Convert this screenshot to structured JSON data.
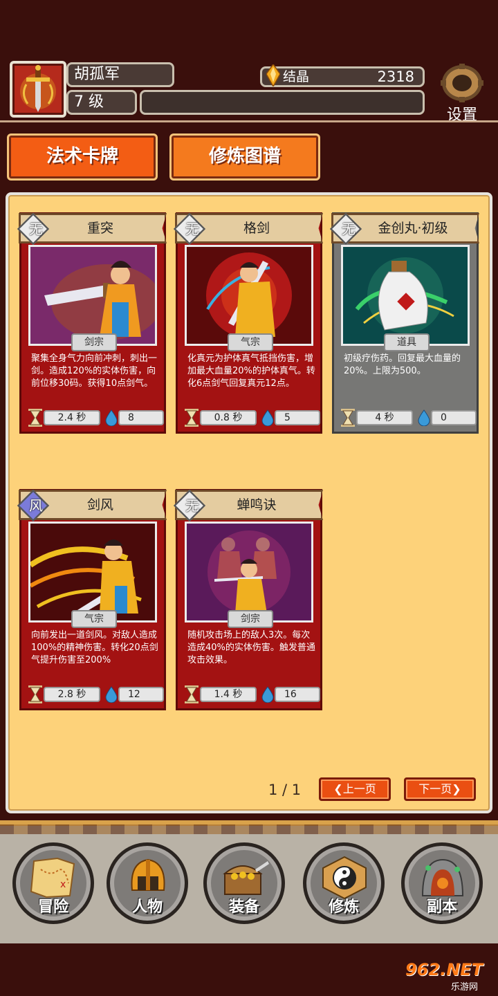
{
  "player": {
    "name": "胡孤军",
    "level": "7 级",
    "crystal_label": "结晶",
    "crystal_value": "2318"
  },
  "settings_label": "设置",
  "tabs": [
    {
      "label": "法术卡牌"
    },
    {
      "label": "修炼图谱"
    }
  ],
  "cards": [
    {
      "title": "重突",
      "element": "无",
      "type": "剑宗",
      "desc": "聚集全身气力向前冲刺，刺出一剑。造成120%的实体伤害，向前位移30码。获得10点剑气。",
      "time": "2.4 秒",
      "cost": "8"
    },
    {
      "title": "格剑",
      "element": "无",
      "type": "气宗",
      "desc": "化真元为护体真气抵挡伤害，增加最大血量20%的护体真气。转化6点剑气回复真元12点。",
      "time": "0.8 秒",
      "cost": "5"
    },
    {
      "title": "金创丸·初级",
      "element": "无",
      "type": "道具",
      "desc": "初级疗伤药。回复最大血量的20%。上限为500。",
      "time": "4 秒",
      "cost": "0"
    },
    {
      "title": "剑风",
      "element": "风",
      "type": "气宗",
      "desc": "向前发出一道剑风。对敌人造成100%的精神伤害。转化20点剑气提升伤害至200%",
      "time": "2.8 秒",
      "cost": "12"
    },
    {
      "title": "蝉鸣诀",
      "element": "无",
      "type": "剑宗",
      "desc": "随机攻击场上的敌人3次。每次造成40%的实体伤害。触发普通攻击效果。",
      "time": "1.4 秒",
      "cost": "16"
    }
  ],
  "pagination": {
    "indicator": "1 / 1",
    "prev_label": "❮上一页",
    "next_label": "下一页❯"
  },
  "nav": [
    {
      "label": "冒险",
      "icon": "map-icon"
    },
    {
      "label": "人物",
      "icon": "helmet-icon"
    },
    {
      "label": "装备",
      "icon": "treasure-chest-icon"
    },
    {
      "label": "修炼",
      "icon": "yin-yang-icon"
    },
    {
      "label": "副本",
      "icon": "cave-portal-icon"
    }
  ],
  "watermark": {
    "main": "962.NET",
    "sub": "乐游网"
  },
  "colors": {
    "background": "#3a0f0c",
    "panel": "#fdd27a",
    "card_red": "#a31212",
    "card_gray": "#777775",
    "tab_orange": "#f35d14",
    "page_button": "#ea4f12"
  }
}
